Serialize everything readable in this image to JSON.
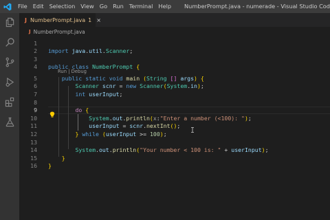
{
  "titlebar": {
    "menu": [
      "File",
      "Edit",
      "Selection",
      "View",
      "Go",
      "Run",
      "Terminal",
      "Help"
    ],
    "window_title": "NumberPrompt.java - numerade - Visual Studio Code"
  },
  "activitybar": {
    "icons": [
      "explorer-icon",
      "search-icon",
      "source-control-icon",
      "run-debug-icon",
      "extensions-icon",
      "testing-icon"
    ]
  },
  "tab": {
    "java_glyph": "J",
    "label": "NumberPrompt.java",
    "badge": "1",
    "close": "×"
  },
  "breadcrumb": {
    "java_glyph": "J",
    "label": "NumberPrompt.java"
  },
  "codelens": "Run | Debug",
  "editor": {
    "line_numbers": [
      "1",
      "2",
      "3",
      "4",
      "5",
      "6",
      "7",
      "8",
      "9",
      "10",
      "11",
      "12",
      "13",
      "14",
      "15",
      "16"
    ],
    "active_line": "9",
    "lines": [
      "",
      "import java.util.Scanner;",
      "",
      "public class NumberPrompt {",
      "    public static void main (String [] args) {",
      "        Scanner scnr = new Scanner(System.in);",
      "        int userInput;",
      "",
      "        do {",
      "            System.out.println(x:\"Enter a number (<100): \");",
      "            userInput = scnr.nextInt();",
      "        } while (userInput >= 100);",
      "",
      "        System.out.println(\"Your number < 100 is: \" + userInput);",
      "    }",
      "}"
    ]
  }
}
